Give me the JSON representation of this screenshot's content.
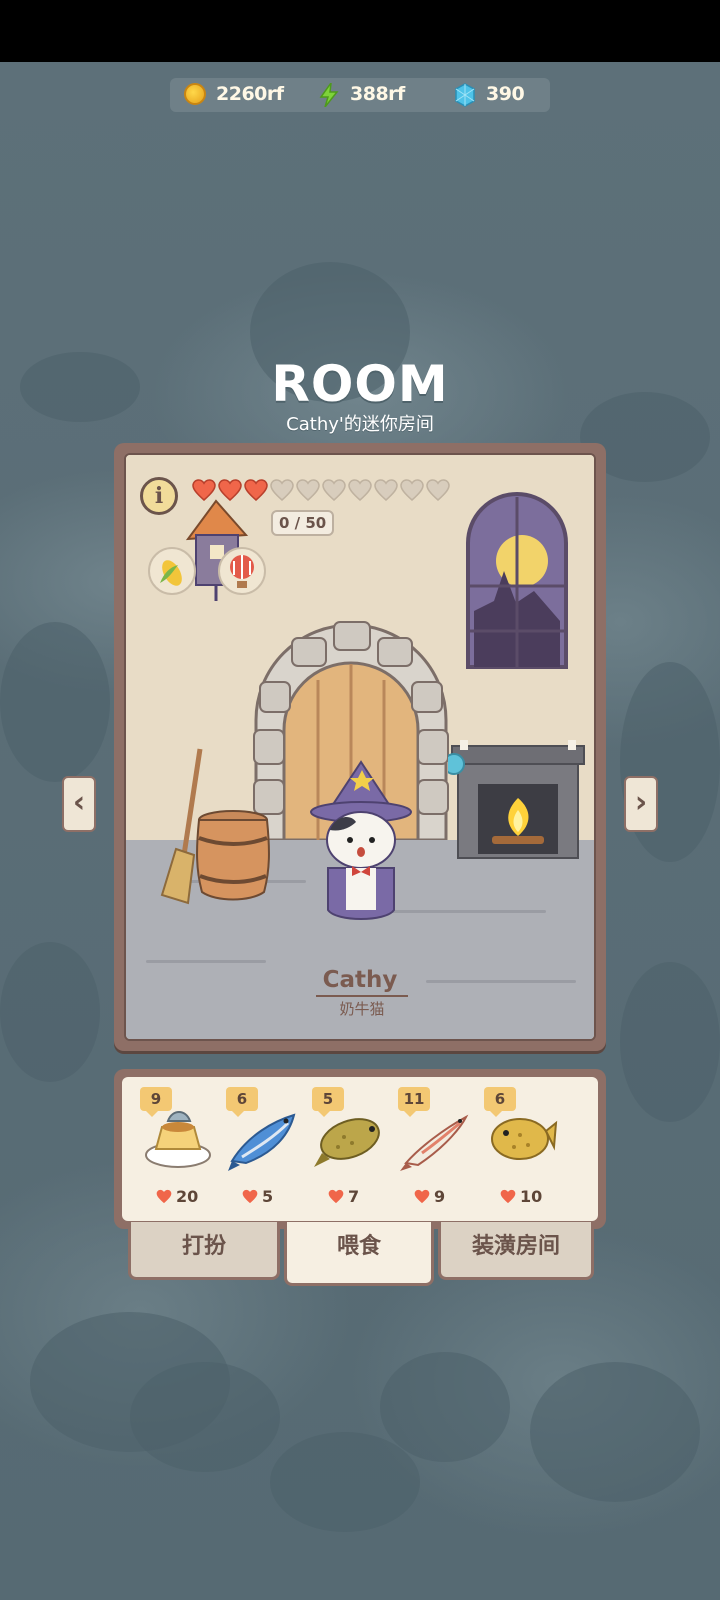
{
  "currency": {
    "coins": "2260rf",
    "energy": "388rf",
    "gems": "390"
  },
  "room": {
    "title": "ROOM",
    "subtitle": "Cathy'的迷你房间",
    "hearts_filled": 3,
    "hearts_total": 10,
    "progress": "0 / 50",
    "info_label": "i"
  },
  "pet": {
    "name": "Cathy",
    "breed": "奶牛猫"
  },
  "navigation": {
    "prev": "‹",
    "next": "›"
  },
  "food_items": [
    {
      "count": "9",
      "hearts": "20",
      "kind": "pudding-fish"
    },
    {
      "count": "6",
      "hearts": "5",
      "kind": "tuna"
    },
    {
      "count": "5",
      "hearts": "7",
      "kind": "carp"
    },
    {
      "count": "11",
      "hearts": "9",
      "kind": "small-fish"
    },
    {
      "count": "6",
      "hearts": "10",
      "kind": "flatfish"
    }
  ],
  "tabs": {
    "dress": "打扮",
    "feed": "喂食",
    "decorate": "装潢房间",
    "active": "feed"
  },
  "colors": {
    "heart_filled": "#f0664a",
    "heart_empty": "#d8cdbd",
    "frame": "#8e6f66"
  }
}
